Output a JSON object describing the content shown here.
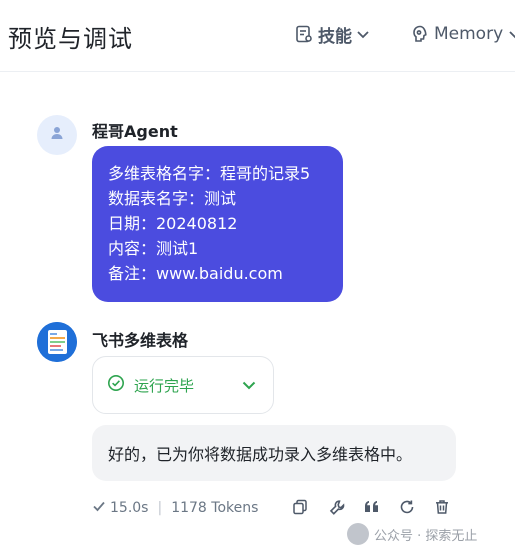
{
  "header": {
    "title": "预览与调试",
    "skills_label": "技能",
    "memory_label": "Memory"
  },
  "agent_message": {
    "sender": "程哥Agent",
    "lines": [
      "多维表格名字：程哥的记录5",
      "数据表名字：测试",
      "日期：20240812",
      "内容：测试1",
      "备注：www.baidu.com"
    ]
  },
  "bot_message": {
    "sender": "飞书多维表格",
    "status": "运行完毕",
    "reply": "好的，已为你将数据成功录入多维表格中。",
    "duration": "15.0s",
    "tokens": "1178 Tokens"
  },
  "watermark": {
    "text": "公众号 · 探索无止"
  },
  "colors": {
    "bubble": "#4b4cdf",
    "success": "#2ea44f",
    "muted": "#6b7785"
  },
  "icons": [
    "skills-icon",
    "chevron-down-icon",
    "memory-brain-icon",
    "user-avatar-icon",
    "bot-avatar-icon",
    "check-circle-icon",
    "check-icon",
    "copy-icon",
    "wrench-icon",
    "quote-icon",
    "refresh-icon",
    "trash-icon"
  ]
}
